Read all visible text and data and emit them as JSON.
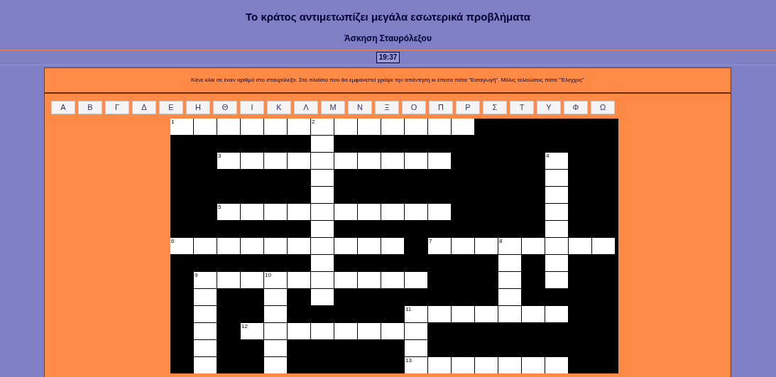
{
  "title": "Το κράτος αντιμετωπίζει μεγάλα εσωτερικά προβλήματα",
  "subtitle": "Άσκηση Σταυρόλεξου",
  "timer": "19:37",
  "instructions": "Κάνε κλικ σε έναν αριθμό στο σταυρόλεξο. Στο πλαίσιο που θα εμφανιστεί γράψε την απάντηση κι έπειτα πάτα \"Εισαγωγή\". Μόλις τελειώσεις πάτα \"Έλεγχος\"",
  "letters": [
    "Α",
    "Β",
    "Γ",
    "Δ",
    "Ε",
    "Η",
    "Θ",
    "Ι",
    "Κ",
    "Λ",
    "Μ",
    "Ν",
    "Ξ",
    "Ο",
    "Π",
    "Ρ",
    "Σ",
    "Τ",
    "Υ",
    "Φ",
    "Ω"
  ],
  "grid": [
    [
      {
        "kind": "open",
        "number": "1"
      },
      {
        "kind": "open"
      },
      {
        "kind": "open"
      },
      {
        "kind": "open"
      },
      {
        "kind": "open"
      },
      {
        "kind": "open"
      },
      {
        "kind": "open",
        "number": "2"
      },
      {
        "kind": "open"
      },
      {
        "kind": "open"
      },
      {
        "kind": "open"
      },
      {
        "kind": "open"
      },
      {
        "kind": "open"
      },
      {
        "kind": "open"
      },
      {
        "kind": "block"
      },
      {
        "kind": "block"
      },
      {
        "kind": "block"
      },
      {
        "kind": "block"
      },
      {
        "kind": "block"
      },
      {
        "kind": "block"
      }
    ],
    [
      {
        "kind": "block"
      },
      {
        "kind": "block"
      },
      {
        "kind": "block"
      },
      {
        "kind": "block"
      },
      {
        "kind": "block"
      },
      {
        "kind": "block"
      },
      {
        "kind": "open"
      },
      {
        "kind": "block"
      },
      {
        "kind": "block"
      },
      {
        "kind": "block"
      },
      {
        "kind": "block"
      },
      {
        "kind": "block"
      },
      {
        "kind": "block"
      },
      {
        "kind": "block"
      },
      {
        "kind": "block"
      },
      {
        "kind": "block"
      },
      {
        "kind": "block"
      },
      {
        "kind": "block"
      },
      {
        "kind": "block"
      }
    ],
    [
      {
        "kind": "block"
      },
      {
        "kind": "block"
      },
      {
        "kind": "open",
        "number": "3"
      },
      {
        "kind": "open"
      },
      {
        "kind": "open"
      },
      {
        "kind": "open"
      },
      {
        "kind": "open"
      },
      {
        "kind": "open"
      },
      {
        "kind": "open"
      },
      {
        "kind": "open"
      },
      {
        "kind": "open"
      },
      {
        "kind": "open"
      },
      {
        "kind": "block"
      },
      {
        "kind": "block"
      },
      {
        "kind": "block"
      },
      {
        "kind": "block"
      },
      {
        "kind": "open",
        "number": "4"
      },
      {
        "kind": "block"
      },
      {
        "kind": "block"
      }
    ],
    [
      {
        "kind": "block"
      },
      {
        "kind": "block"
      },
      {
        "kind": "block"
      },
      {
        "kind": "block"
      },
      {
        "kind": "block"
      },
      {
        "kind": "block"
      },
      {
        "kind": "open"
      },
      {
        "kind": "block"
      },
      {
        "kind": "block"
      },
      {
        "kind": "block"
      },
      {
        "kind": "block"
      },
      {
        "kind": "block"
      },
      {
        "kind": "block"
      },
      {
        "kind": "block"
      },
      {
        "kind": "block"
      },
      {
        "kind": "block"
      },
      {
        "kind": "open"
      },
      {
        "kind": "block"
      },
      {
        "kind": "block"
      }
    ],
    [
      {
        "kind": "block"
      },
      {
        "kind": "block"
      },
      {
        "kind": "block"
      },
      {
        "kind": "block"
      },
      {
        "kind": "block"
      },
      {
        "kind": "block"
      },
      {
        "kind": "open"
      },
      {
        "kind": "block"
      },
      {
        "kind": "block"
      },
      {
        "kind": "block"
      },
      {
        "kind": "block"
      },
      {
        "kind": "block"
      },
      {
        "kind": "block"
      },
      {
        "kind": "block"
      },
      {
        "kind": "block"
      },
      {
        "kind": "block"
      },
      {
        "kind": "open"
      },
      {
        "kind": "block"
      },
      {
        "kind": "block"
      }
    ],
    [
      {
        "kind": "block"
      },
      {
        "kind": "block"
      },
      {
        "kind": "open",
        "number": "5"
      },
      {
        "kind": "open"
      },
      {
        "kind": "open"
      },
      {
        "kind": "open"
      },
      {
        "kind": "open"
      },
      {
        "kind": "open"
      },
      {
        "kind": "open"
      },
      {
        "kind": "open"
      },
      {
        "kind": "open"
      },
      {
        "kind": "open"
      },
      {
        "kind": "block"
      },
      {
        "kind": "block"
      },
      {
        "kind": "block"
      },
      {
        "kind": "block"
      },
      {
        "kind": "open"
      },
      {
        "kind": "block"
      },
      {
        "kind": "block"
      }
    ],
    [
      {
        "kind": "block"
      },
      {
        "kind": "block"
      },
      {
        "kind": "block"
      },
      {
        "kind": "block"
      },
      {
        "kind": "block"
      },
      {
        "kind": "block"
      },
      {
        "kind": "open"
      },
      {
        "kind": "block"
      },
      {
        "kind": "block"
      },
      {
        "kind": "block"
      },
      {
        "kind": "block"
      },
      {
        "kind": "block"
      },
      {
        "kind": "block"
      },
      {
        "kind": "block"
      },
      {
        "kind": "block"
      },
      {
        "kind": "block"
      },
      {
        "kind": "open"
      },
      {
        "kind": "block"
      },
      {
        "kind": "block"
      }
    ],
    [
      {
        "kind": "open",
        "number": "6"
      },
      {
        "kind": "open"
      },
      {
        "kind": "open"
      },
      {
        "kind": "open"
      },
      {
        "kind": "open"
      },
      {
        "kind": "open"
      },
      {
        "kind": "open"
      },
      {
        "kind": "open"
      },
      {
        "kind": "open"
      },
      {
        "kind": "open"
      },
      {
        "kind": "block"
      },
      {
        "kind": "open",
        "number": "7"
      },
      {
        "kind": "open"
      },
      {
        "kind": "open"
      },
      {
        "kind": "open",
        "number": "8"
      },
      {
        "kind": "open"
      },
      {
        "kind": "open"
      },
      {
        "kind": "open"
      },
      {
        "kind": "open"
      }
    ],
    [
      {
        "kind": "block"
      },
      {
        "kind": "block"
      },
      {
        "kind": "block"
      },
      {
        "kind": "block"
      },
      {
        "kind": "block"
      },
      {
        "kind": "block"
      },
      {
        "kind": "open"
      },
      {
        "kind": "block"
      },
      {
        "kind": "block"
      },
      {
        "kind": "block"
      },
      {
        "kind": "block"
      },
      {
        "kind": "block"
      },
      {
        "kind": "block"
      },
      {
        "kind": "block"
      },
      {
        "kind": "open"
      },
      {
        "kind": "block"
      },
      {
        "kind": "open"
      },
      {
        "kind": "block"
      },
      {
        "kind": "block"
      }
    ],
    [
      {
        "kind": "block"
      },
      {
        "kind": "open",
        "number": "9"
      },
      {
        "kind": "open"
      },
      {
        "kind": "open"
      },
      {
        "kind": "open",
        "number": "10"
      },
      {
        "kind": "open"
      },
      {
        "kind": "open"
      },
      {
        "kind": "open"
      },
      {
        "kind": "open"
      },
      {
        "kind": "open"
      },
      {
        "kind": "open"
      },
      {
        "kind": "block"
      },
      {
        "kind": "block"
      },
      {
        "kind": "block"
      },
      {
        "kind": "open"
      },
      {
        "kind": "block"
      },
      {
        "kind": "open"
      },
      {
        "kind": "block"
      },
      {
        "kind": "block"
      }
    ],
    [
      {
        "kind": "block"
      },
      {
        "kind": "open"
      },
      {
        "kind": "block"
      },
      {
        "kind": "block"
      },
      {
        "kind": "open"
      },
      {
        "kind": "block"
      },
      {
        "kind": "open"
      },
      {
        "kind": "block"
      },
      {
        "kind": "block"
      },
      {
        "kind": "block"
      },
      {
        "kind": "block"
      },
      {
        "kind": "block"
      },
      {
        "kind": "block"
      },
      {
        "kind": "block"
      },
      {
        "kind": "open"
      },
      {
        "kind": "block"
      },
      {
        "kind": "block"
      },
      {
        "kind": "block"
      },
      {
        "kind": "block"
      }
    ],
    [
      {
        "kind": "block"
      },
      {
        "kind": "open"
      },
      {
        "kind": "block"
      },
      {
        "kind": "block"
      },
      {
        "kind": "open"
      },
      {
        "kind": "block"
      },
      {
        "kind": "block"
      },
      {
        "kind": "block"
      },
      {
        "kind": "block"
      },
      {
        "kind": "block"
      },
      {
        "kind": "open",
        "number": "11"
      },
      {
        "kind": "open"
      },
      {
        "kind": "open"
      },
      {
        "kind": "open"
      },
      {
        "kind": "open"
      },
      {
        "kind": "open"
      },
      {
        "kind": "open"
      },
      {
        "kind": "block"
      },
      {
        "kind": "block"
      }
    ],
    [
      {
        "kind": "block"
      },
      {
        "kind": "open"
      },
      {
        "kind": "block"
      },
      {
        "kind": "open",
        "number": "12"
      },
      {
        "kind": "open"
      },
      {
        "kind": "open"
      },
      {
        "kind": "open"
      },
      {
        "kind": "open"
      },
      {
        "kind": "open"
      },
      {
        "kind": "open"
      },
      {
        "kind": "open"
      },
      {
        "kind": "block"
      },
      {
        "kind": "block"
      },
      {
        "kind": "block"
      },
      {
        "kind": "block"
      },
      {
        "kind": "block"
      },
      {
        "kind": "block"
      },
      {
        "kind": "block"
      },
      {
        "kind": "block"
      }
    ],
    [
      {
        "kind": "block"
      },
      {
        "kind": "open"
      },
      {
        "kind": "block"
      },
      {
        "kind": "block"
      },
      {
        "kind": "open"
      },
      {
        "kind": "block"
      },
      {
        "kind": "block"
      },
      {
        "kind": "block"
      },
      {
        "kind": "block"
      },
      {
        "kind": "block"
      },
      {
        "kind": "open"
      },
      {
        "kind": "block"
      },
      {
        "kind": "block"
      },
      {
        "kind": "block"
      },
      {
        "kind": "block"
      },
      {
        "kind": "block"
      },
      {
        "kind": "block"
      },
      {
        "kind": "block"
      },
      {
        "kind": "block"
      }
    ],
    [
      {
        "kind": "block"
      },
      {
        "kind": "open"
      },
      {
        "kind": "block"
      },
      {
        "kind": "block"
      },
      {
        "kind": "open"
      },
      {
        "kind": "block"
      },
      {
        "kind": "block"
      },
      {
        "kind": "block"
      },
      {
        "kind": "block"
      },
      {
        "kind": "block"
      },
      {
        "kind": "open",
        "number": "13"
      },
      {
        "kind": "open"
      },
      {
        "kind": "open"
      },
      {
        "kind": "open"
      },
      {
        "kind": "open"
      },
      {
        "kind": "open"
      },
      {
        "kind": "open"
      },
      {
        "kind": "block"
      },
      {
        "kind": "block"
      }
    ]
  ]
}
